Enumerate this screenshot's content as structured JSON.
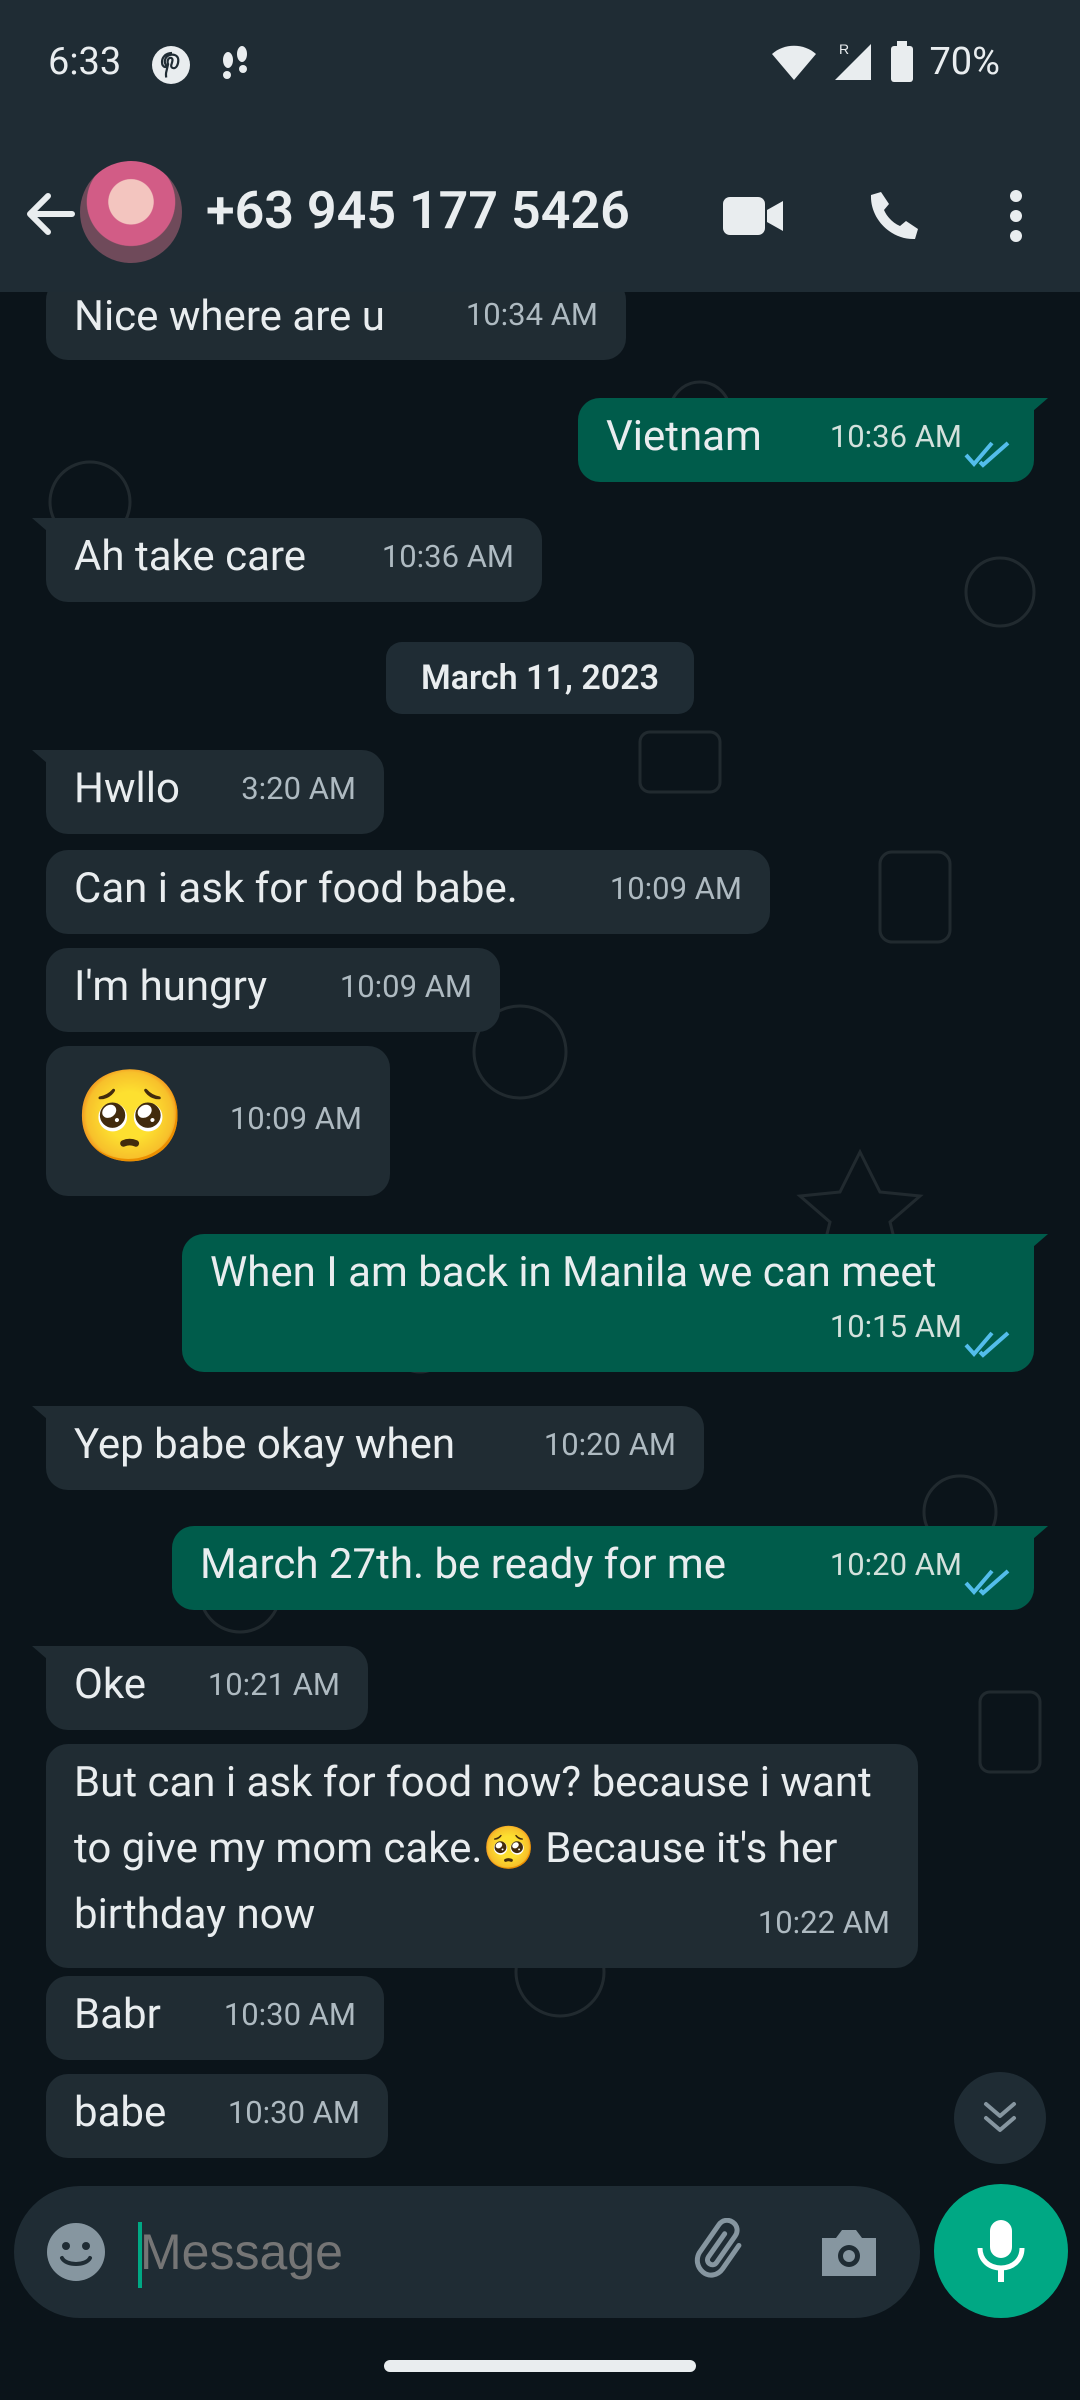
{
  "status_bar": {
    "time": "6:33",
    "battery": "70%"
  },
  "header": {
    "contact": "+63 945 177 5426"
  },
  "date_separator": "March 11, 2023",
  "messages": [
    {
      "dir": "in",
      "text": "Nice where are u",
      "time": "10:34 AM"
    },
    {
      "dir": "out",
      "text": "Vietnam",
      "time": "10:36 AM"
    },
    {
      "dir": "in",
      "text": "Ah take care",
      "time": "10:36 AM"
    },
    {
      "dir": "in",
      "text": "Hwllo",
      "time": "3:20 AM"
    },
    {
      "dir": "in",
      "text": "Can i ask for food babe.",
      "time": "10:09 AM"
    },
    {
      "dir": "in",
      "text": "I'm hungry",
      "time": "10:09 AM"
    },
    {
      "dir": "in",
      "text": "🥺",
      "time": "10:09 AM"
    },
    {
      "dir": "out",
      "text": "When I am back in Manila we can meet",
      "time": "10:15 AM"
    },
    {
      "dir": "in",
      "text": "Yep babe okay when",
      "time": "10:20 AM"
    },
    {
      "dir": "out",
      "text": "March 27th. be ready for me",
      "time": "10:20 AM"
    },
    {
      "dir": "in",
      "text": "Oke",
      "time": "10:21 AM"
    },
    {
      "dir": "in",
      "text": "But can i ask for food now? because i want to give my mom cake.🥺 Because it's her birthday now",
      "time": "10:22 AM"
    },
    {
      "dir": "in",
      "text": "Babr",
      "time": "10:30 AM"
    },
    {
      "dir": "in",
      "text": "babe",
      "time": "10:30 AM"
    }
  ],
  "composer": {
    "placeholder": "Message"
  },
  "colors": {
    "background": "#0b141a",
    "incoming": "#202c33",
    "outgoing": "#005c4b",
    "accent": "#00a884",
    "read_ticks": "#53bdeb"
  },
  "icons": [
    "back-arrow-icon",
    "video-call-icon",
    "phone-icon",
    "more-vert-icon",
    "emoji-icon",
    "attach-icon",
    "camera-icon",
    "mic-icon",
    "double-chevron-down-icon",
    "read-ticks-icon"
  ]
}
